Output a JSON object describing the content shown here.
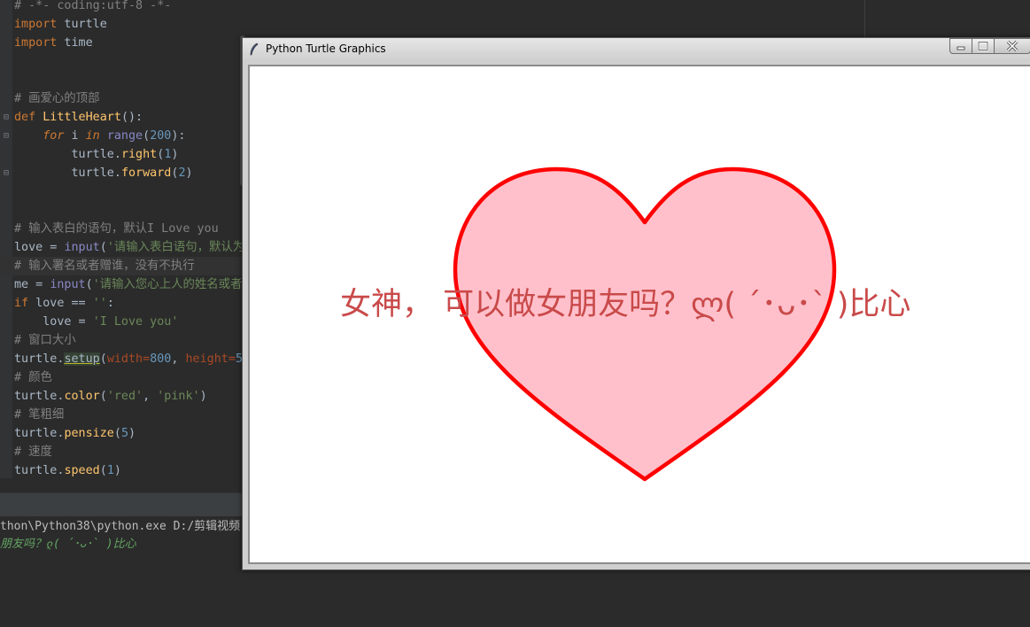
{
  "editor": {
    "lines": [
      {
        "parts": [
          {
            "t": "# -*- coding:utf-8 -*-",
            "c": "c"
          }
        ]
      },
      {
        "parts": [
          {
            "t": "import",
            "c": "kwn"
          },
          {
            "t": " turtle",
            "c": "at"
          }
        ]
      },
      {
        "parts": [
          {
            "t": "import",
            "c": "kwn"
          },
          {
            "t": " time",
            "c": "at"
          }
        ]
      },
      {
        "parts": []
      },
      {
        "parts": []
      },
      {
        "parts": [
          {
            "t": "# 画爱心的顶部",
            "c": "c"
          }
        ]
      },
      {
        "parts": [
          {
            "t": "def",
            "c": "kwn"
          },
          {
            "t": " ",
            "c": "at"
          },
          {
            "t": "LittleHeart",
            "c": "fn"
          },
          {
            "t": "():",
            "c": "at"
          }
        ]
      },
      {
        "parts": [
          {
            "t": "    ",
            "c": "at"
          },
          {
            "t": "for",
            "c": "kwi"
          },
          {
            "t": " i ",
            "c": "at"
          },
          {
            "t": "in",
            "c": "kwi"
          },
          {
            "t": " ",
            "c": "at"
          },
          {
            "t": "range",
            "c": "bi"
          },
          {
            "t": "(",
            "c": "at"
          },
          {
            "t": "200",
            "c": "nm"
          },
          {
            "t": "):",
            "c": "at"
          }
        ]
      },
      {
        "parts": [
          {
            "t": "        turtle.",
            "c": "at"
          },
          {
            "t": "right",
            "c": "fc"
          },
          {
            "t": "(",
            "c": "at"
          },
          {
            "t": "1",
            "c": "nm"
          },
          {
            "t": ")",
            "c": "at"
          }
        ]
      },
      {
        "parts": [
          {
            "t": "        turtle.",
            "c": "at"
          },
          {
            "t": "forward",
            "c": "fc"
          },
          {
            "t": "(",
            "c": "at"
          },
          {
            "t": "2",
            "c": "nm"
          },
          {
            "t": ")",
            "c": "at"
          }
        ]
      },
      {
        "parts": []
      },
      {
        "parts": []
      },
      {
        "parts": [
          {
            "t": "# 输入表白的语句，默认I Love you",
            "c": "c"
          }
        ]
      },
      {
        "parts": [
          {
            "t": "love = ",
            "c": "at"
          },
          {
            "t": "input",
            "c": "bi"
          },
          {
            "t": "(",
            "c": "at"
          },
          {
            "t": "'请输入表白语句，默认为",
            "c": "st"
          }
        ]
      },
      {
        "hl": true,
        "parts": [
          {
            "t": "# 输入署名或者赠谁，没有不执行",
            "c": "c"
          }
        ]
      },
      {
        "parts": [
          {
            "t": "me = ",
            "c": "at"
          },
          {
            "t": "input",
            "c": "bi"
          },
          {
            "t": "(",
            "c": "at"
          },
          {
            "t": "'请输入您心上人的姓名或者赠",
            "c": "st"
          }
        ]
      },
      {
        "parts": [
          {
            "t": "if",
            "c": "kwn"
          },
          {
            "t": " love == ",
            "c": "at"
          },
          {
            "t": "''",
            "c": "st"
          },
          {
            "t": ":",
            "c": "at"
          }
        ]
      },
      {
        "parts": [
          {
            "t": "    love = ",
            "c": "at"
          },
          {
            "t": "'I Love you'",
            "c": "st"
          }
        ]
      },
      {
        "parts": [
          {
            "t": "# 窗口大小",
            "c": "c"
          }
        ]
      },
      {
        "parts": [
          {
            "t": "turtle.",
            "c": "at"
          },
          {
            "t": "setup",
            "c": "sel"
          },
          {
            "t": "(",
            "c": "at"
          },
          {
            "t": "width=",
            "c": "pm"
          },
          {
            "t": "800",
            "c": "nm"
          },
          {
            "t": ", ",
            "c": "at"
          },
          {
            "t": "height=",
            "c": "pm"
          },
          {
            "t": "5",
            "c": "nm"
          }
        ]
      },
      {
        "parts": [
          {
            "t": "# 颜色",
            "c": "c"
          }
        ]
      },
      {
        "parts": [
          {
            "t": "turtle.",
            "c": "at"
          },
          {
            "t": "color",
            "c": "fc"
          },
          {
            "t": "(",
            "c": "at"
          },
          {
            "t": "'red'",
            "c": "st"
          },
          {
            "t": ", ",
            "c": "at"
          },
          {
            "t": "'pink'",
            "c": "st"
          },
          {
            "t": ")",
            "c": "at"
          }
        ]
      },
      {
        "parts": [
          {
            "t": "# 笔粗细",
            "c": "c"
          }
        ]
      },
      {
        "parts": [
          {
            "t": "turtle.",
            "c": "at"
          },
          {
            "t": "pensize",
            "c": "fc"
          },
          {
            "t": "(",
            "c": "at"
          },
          {
            "t": "5",
            "c": "nm"
          },
          {
            "t": ")",
            "c": "at"
          }
        ]
      },
      {
        "parts": [
          {
            "t": "# 速度",
            "c": "c"
          }
        ]
      },
      {
        "parts": [
          {
            "t": "turtle.",
            "c": "at"
          },
          {
            "t": "speed",
            "c": "fc"
          },
          {
            "t": "(",
            "c": "at"
          },
          {
            "t": "1",
            "c": "nm"
          },
          {
            "t": ")",
            "c": "at"
          }
        ]
      }
    ]
  },
  "run": {
    "command": "thon\\Python38\\python.exe D:/剪辑视频",
    "echo": "朋友吗？ლ( ´･ᴗ･` )比心"
  },
  "turtle_window": {
    "title": "Python Turtle Graphics",
    "canvas_text": "女神， 可以做女朋友吗？ლ( ´･ᴗ･` )比心",
    "heart_fill": "#ffc0cb",
    "heart_stroke": "#ff0000",
    "text_color": "#c94a4a"
  }
}
